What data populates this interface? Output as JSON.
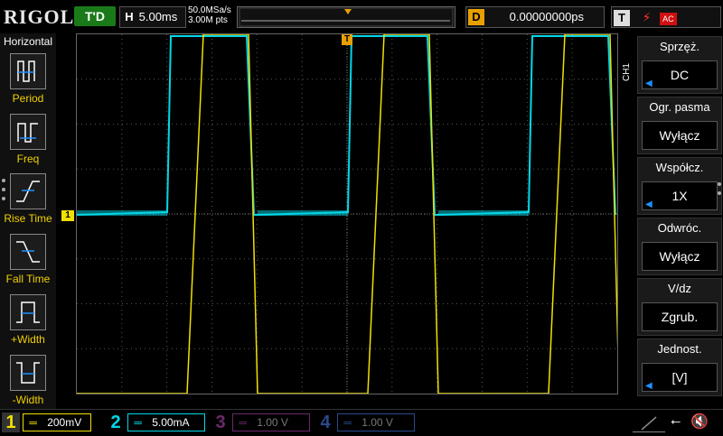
{
  "header": {
    "logo": "RIGOL",
    "run_status": "T'D",
    "timebase_label": "H",
    "timebase_value": "5.00ms",
    "sample_rate": "50.0MSa/s",
    "memory_depth": "3.00M pts",
    "trigger_position_label": "D",
    "trigger_position_value": "0.00000000ps",
    "trigger_label": "T",
    "trigger_coupling": "AC"
  },
  "left_panel": {
    "title": "Horizontal",
    "items": [
      {
        "label": "Period",
        "icon": "period-icon"
      },
      {
        "label": "Freq",
        "icon": "freq-icon"
      },
      {
        "label": "Rise Time",
        "icon": "rise-time-icon"
      },
      {
        "label": "Fall Time",
        "icon": "fall-time-icon"
      },
      {
        "label": "+Width",
        "icon": "pos-width-icon"
      },
      {
        "label": "-Width",
        "icon": "neg-width-icon"
      }
    ]
  },
  "right_panel": {
    "channel": "CH1",
    "items": [
      {
        "title": "Sprzęż.",
        "value": "DC"
      },
      {
        "title": "Ogr. pasma",
        "value": "Wyłącz"
      },
      {
        "title": "Współcz.",
        "value": "1X"
      },
      {
        "title": "Odwróc.",
        "value": "Wyłącz"
      },
      {
        "title": "V/dz",
        "value": "Zgrub."
      },
      {
        "title": "Jednost.",
        "value": "[V]"
      }
    ]
  },
  "channels": [
    {
      "num": "1",
      "scale": "200mV",
      "color": "#f0e000"
    },
    {
      "num": "2",
      "scale": "5.00mA",
      "color": "#00d8e8"
    },
    {
      "num": "3",
      "scale": "1.00 V",
      "color": "#c020c0"
    },
    {
      "num": "4",
      "scale": "1.00 V",
      "color": "#1e6fe0"
    }
  ],
  "markers": {
    "ch1_marker": "1",
    "trigger_marker": "T"
  },
  "colors": {
    "ch1": "#f0e000",
    "ch2": "#00d8e8",
    "trigger": "#e8a000"
  }
}
